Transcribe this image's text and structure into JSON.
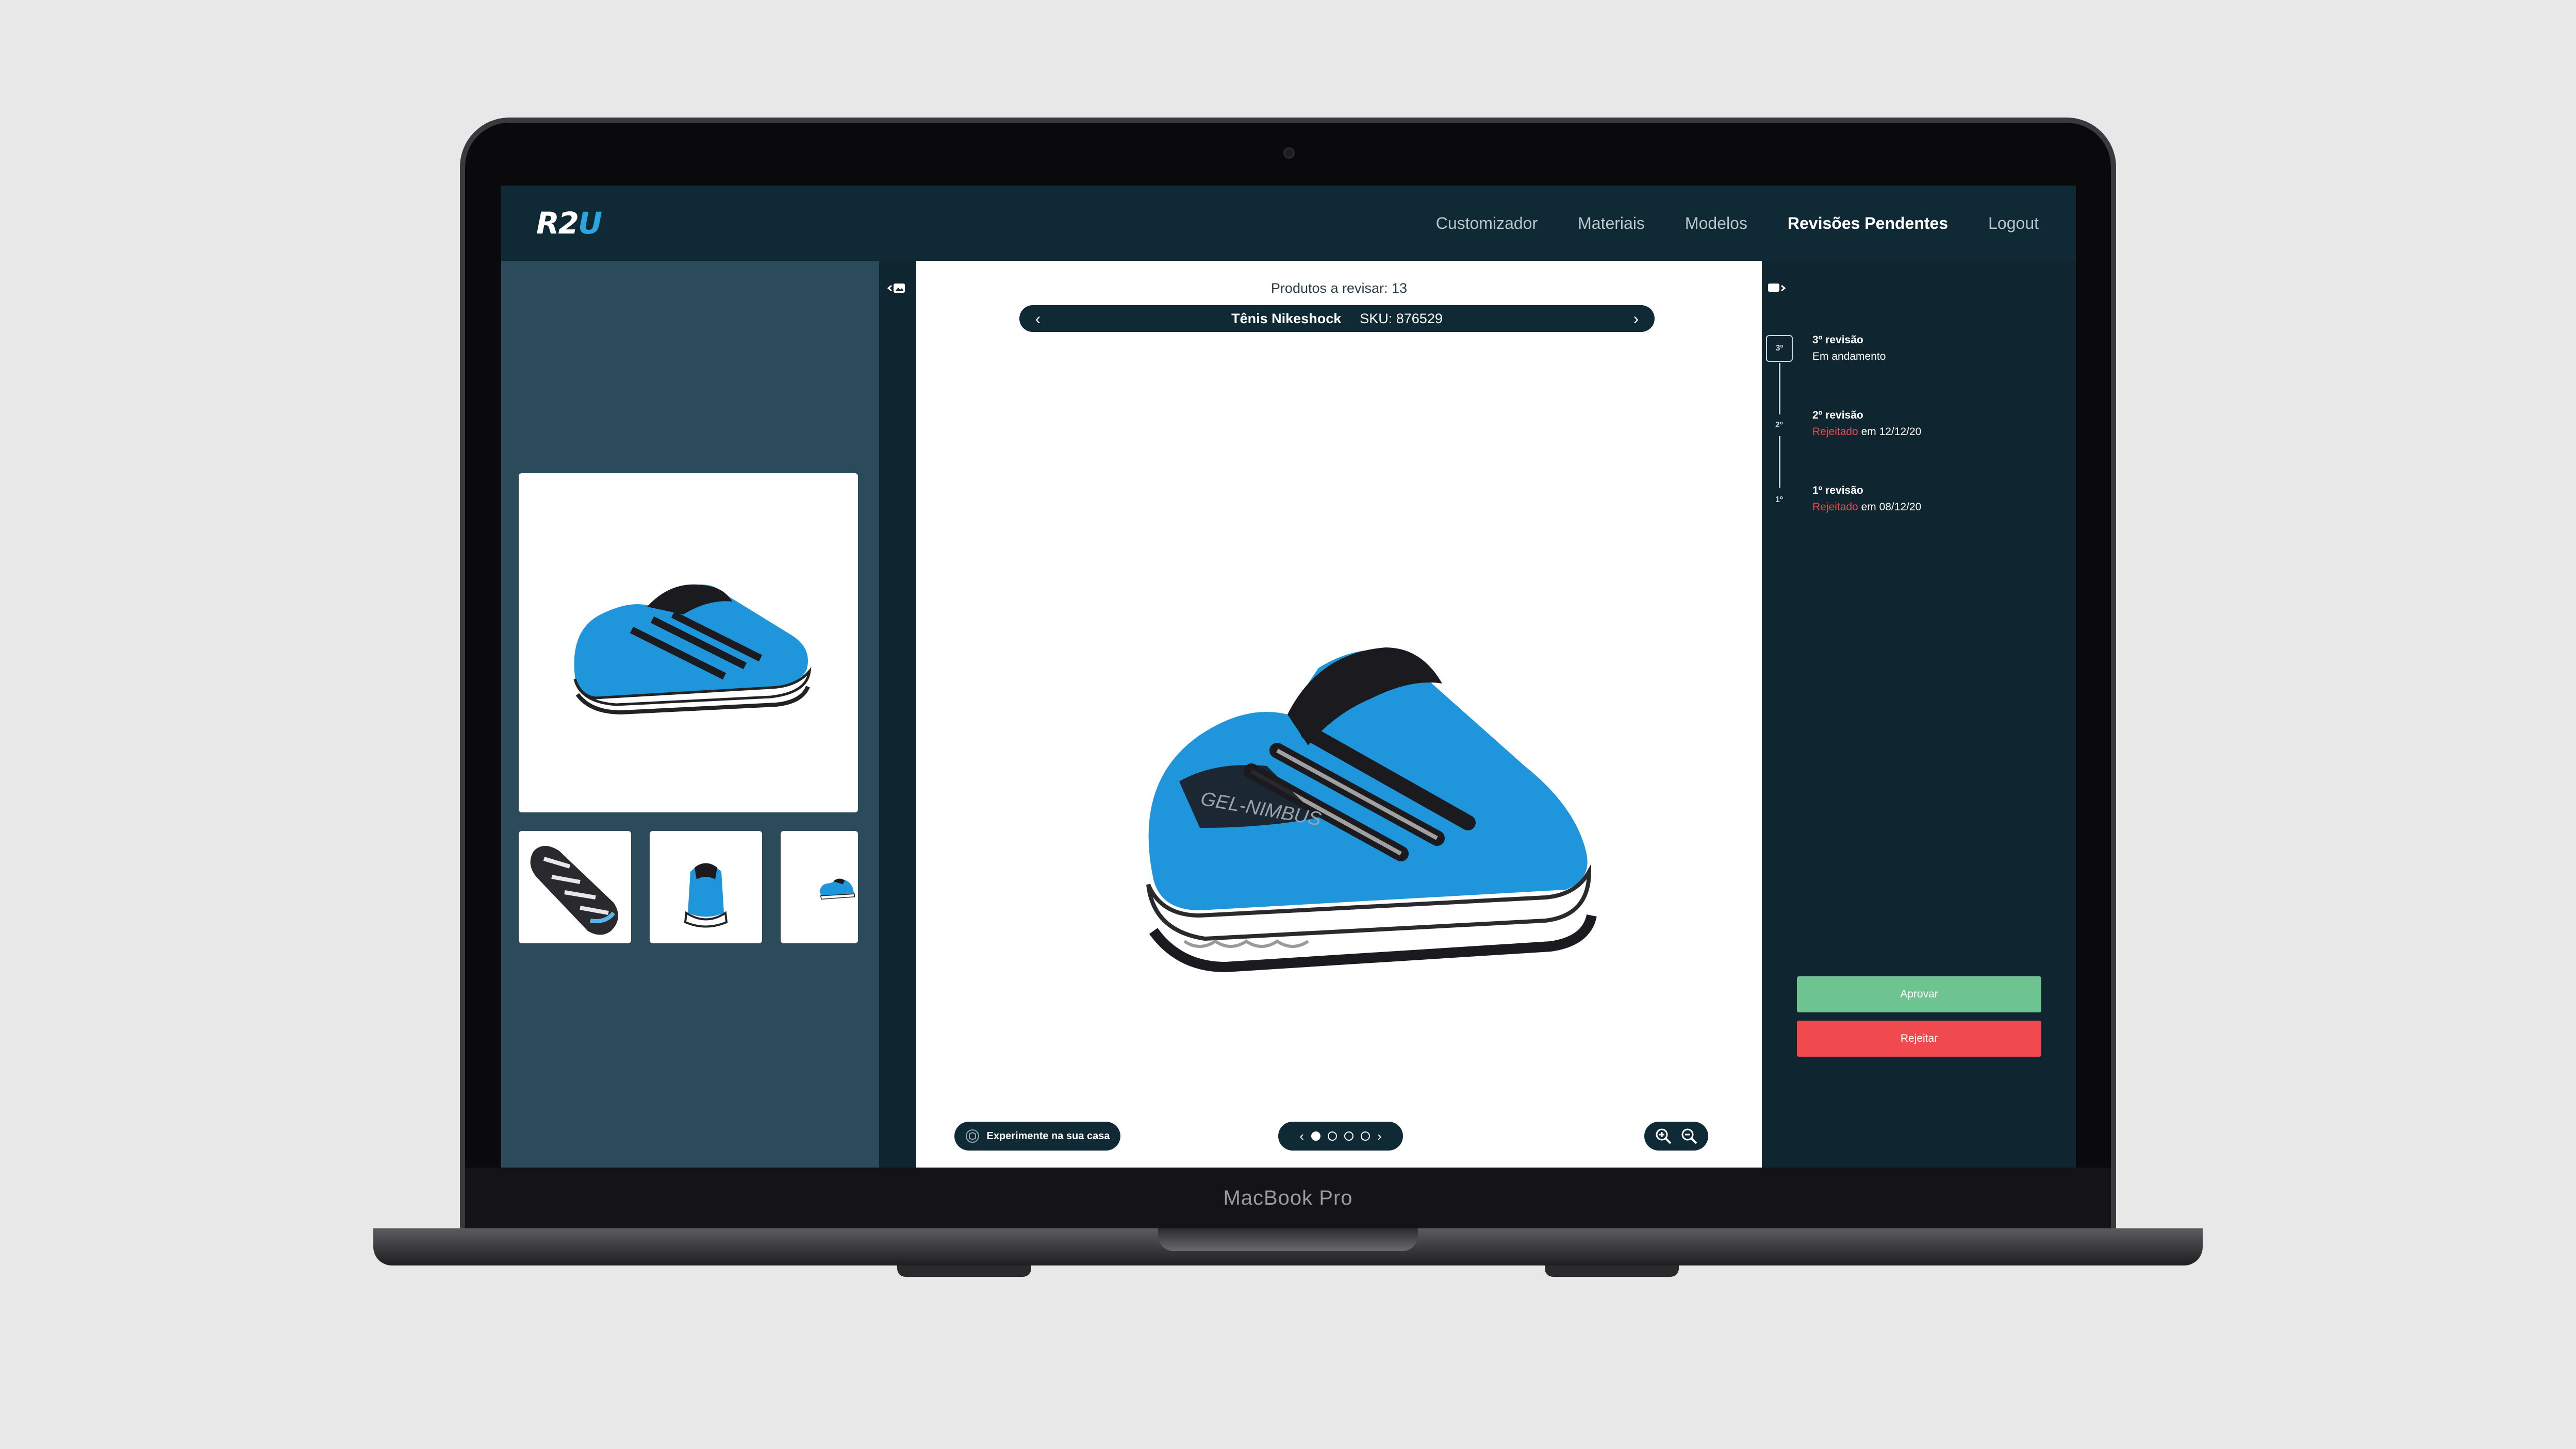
{
  "laptop": {
    "model_label": "MacBook Pro"
  },
  "app": {
    "logo": {
      "part1": "R2",
      "part2": "U"
    },
    "nav": [
      {
        "label": "Customizador",
        "active": false
      },
      {
        "label": "Materiais",
        "active": false
      },
      {
        "label": "Modelos",
        "active": false
      },
      {
        "label": "Revisões Pendentes",
        "active": true
      },
      {
        "label": "Logout",
        "active": false
      }
    ]
  },
  "viewer": {
    "count_label": "Produtos a revisar: 13",
    "product_name": "Tênis Nikeshock",
    "sku_label": "SKU: 876529",
    "prev_arrow": "‹",
    "next_arrow": "›",
    "try_button": "Experimente na sua casa",
    "pager": {
      "prev": "‹",
      "next": "›",
      "pages": 4,
      "current": 1
    }
  },
  "revisions": [
    {
      "num": "3º",
      "title": "3º revisão",
      "status": "Em andamento",
      "rejected_word": "",
      "date_text": ""
    },
    {
      "num": "2º",
      "title": "2º revisão",
      "status": "",
      "rejected_word": "Rejeitado",
      "date_text": " em 12/12/20"
    },
    {
      "num": "1º",
      "title": "1º revisão",
      "status": "",
      "rejected_word": "Rejeitado",
      "date_text": " em 08/12/20"
    }
  ],
  "actions": {
    "approve": "Aprovar",
    "reject": "Rejeitar"
  },
  "colors": {
    "navy": "#0f2a35",
    "panel": "#2b4a5a",
    "brand_blue": "#29a6e0",
    "approve_green": "#6dc491",
    "reject_red": "#f04a4f",
    "shoe_blue": "#1f96dc"
  }
}
